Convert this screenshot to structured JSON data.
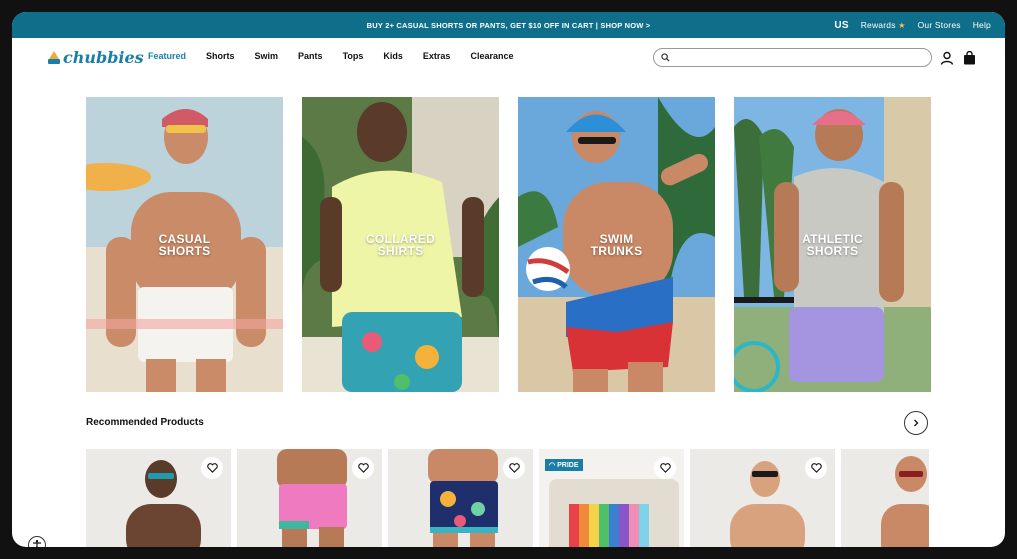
{
  "promo": {
    "text": "BUY 2+ CASUAL SHORTS OR PANTS, GET $10 OFF IN CART | SHOP NOW >",
    "country": "US",
    "rewards": "Rewards",
    "stores": "Our Stores",
    "help": "Help"
  },
  "brand": {
    "name": "chubbies",
    "color": "#1a7fa8"
  },
  "nav": {
    "items": [
      "Featured",
      "Shorts",
      "Swim",
      "Pants",
      "Tops",
      "Kids",
      "Extras",
      "Clearance"
    ],
    "active": "Featured"
  },
  "search": {
    "placeholder": "",
    "icon": "search-icon"
  },
  "header_icons": [
    "account-icon",
    "bag-icon"
  ],
  "categories": [
    {
      "label": "CASUAL\nSHORTS"
    },
    {
      "label": "COLLARED\nSHIRTS"
    },
    {
      "label": "SWIM\nTRUNKS"
    },
    {
      "label": "ATHLETIC\nSHORTS"
    }
  ],
  "recommended": {
    "title": "Recommended Products",
    "badge": "PRIDE"
  },
  "colors": {
    "promo_bar": "#0f6e8a",
    "accent": "#1a7fa8"
  }
}
